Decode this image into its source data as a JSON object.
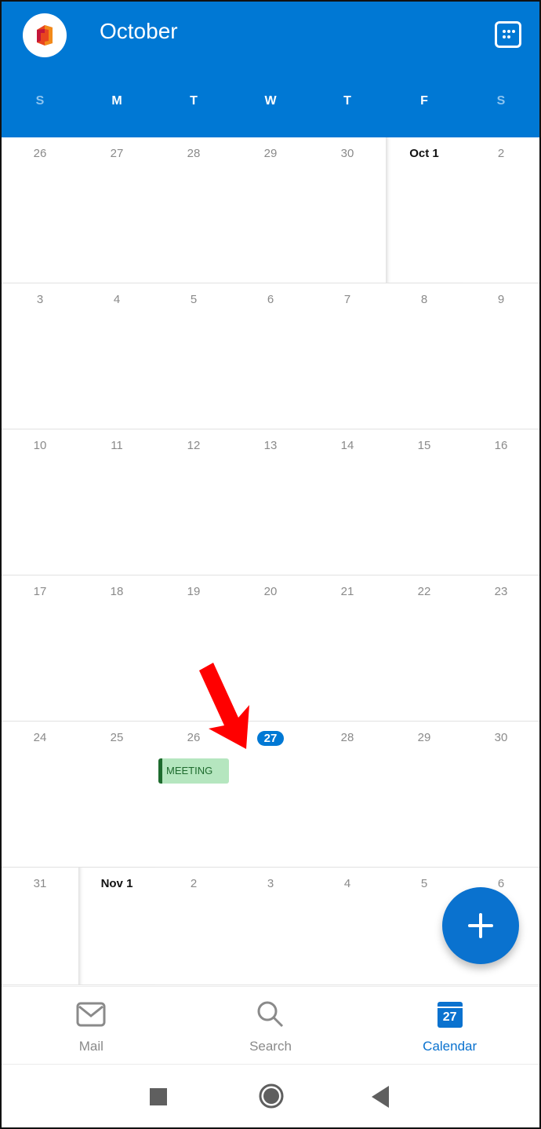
{
  "header": {
    "title": "October",
    "app_icon": "office-logo-icon",
    "view_switch_icon": "calendar-grid-icon",
    "weekdays": [
      "S",
      "M",
      "T",
      "W",
      "T",
      "F",
      "S"
    ]
  },
  "calendar": {
    "today": "27",
    "weeks": [
      [
        "26",
        "27",
        "28",
        "29",
        "30",
        "Oct 1",
        "2"
      ],
      [
        "3",
        "4",
        "5",
        "6",
        "7",
        "8",
        "9"
      ],
      [
        "10",
        "11",
        "12",
        "13",
        "14",
        "15",
        "16"
      ],
      [
        "17",
        "18",
        "19",
        "20",
        "21",
        "22",
        "23"
      ],
      [
        "24",
        "25",
        "26",
        "27",
        "28",
        "29",
        "30"
      ],
      [
        "31",
        "Nov 1",
        "2",
        "3",
        "4",
        "5",
        "6"
      ]
    ],
    "event": {
      "title": "MEETING",
      "day": "27",
      "color": "#b5e6bf",
      "accent": "#1e6b2e"
    }
  },
  "annotation": {
    "type": "red-arrow",
    "color": "#ff0000"
  },
  "fab": {
    "icon": "plus-icon",
    "color": "#0a72cf"
  },
  "bottom_nav": {
    "items": [
      {
        "label": "Mail",
        "icon": "mail-icon",
        "active": false
      },
      {
        "label": "Search",
        "icon": "search-icon",
        "active": false
      },
      {
        "label": "Calendar",
        "icon": "calendar-icon",
        "icon_text": "27",
        "active": true
      }
    ]
  },
  "system_nav": [
    "recents-button",
    "home-button",
    "back-button"
  ],
  "colors": {
    "brand": "#0078d4",
    "active": "#0a72cf",
    "muted": "#8a8a8a"
  }
}
